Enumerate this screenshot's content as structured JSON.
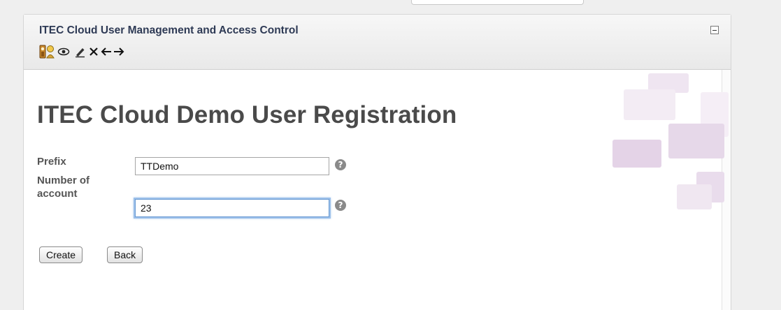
{
  "panel": {
    "title": "ITEC Cloud User Management and Access Control",
    "toolbar": [
      {
        "icon": "user-profile-icon",
        "glyph": "👥"
      },
      {
        "icon": "view-icon",
        "glyph": "👁"
      },
      {
        "icon": "edit-icon",
        "glyph": "✍"
      },
      {
        "icon": "delete-icon",
        "glyph": "✕"
      },
      {
        "icon": "arrow-left-icon",
        "glyph": "←"
      },
      {
        "icon": "arrow-right-icon",
        "glyph": "→"
      }
    ]
  },
  "form": {
    "heading": "ITEC Cloud Demo User Registration",
    "prefix_label": "Prefix",
    "prefix_value": "TTDemo",
    "count_label_line1": "Number of",
    "count_label_line2": "account",
    "count_value": "23",
    "help_glyph": "?",
    "create_label": "Create",
    "back_label": "Back"
  },
  "colors": {
    "title": "#2e3a55",
    "heading": "#4a4a4a",
    "focus": "#6a9bd3",
    "deco": "#e6d8e9"
  }
}
